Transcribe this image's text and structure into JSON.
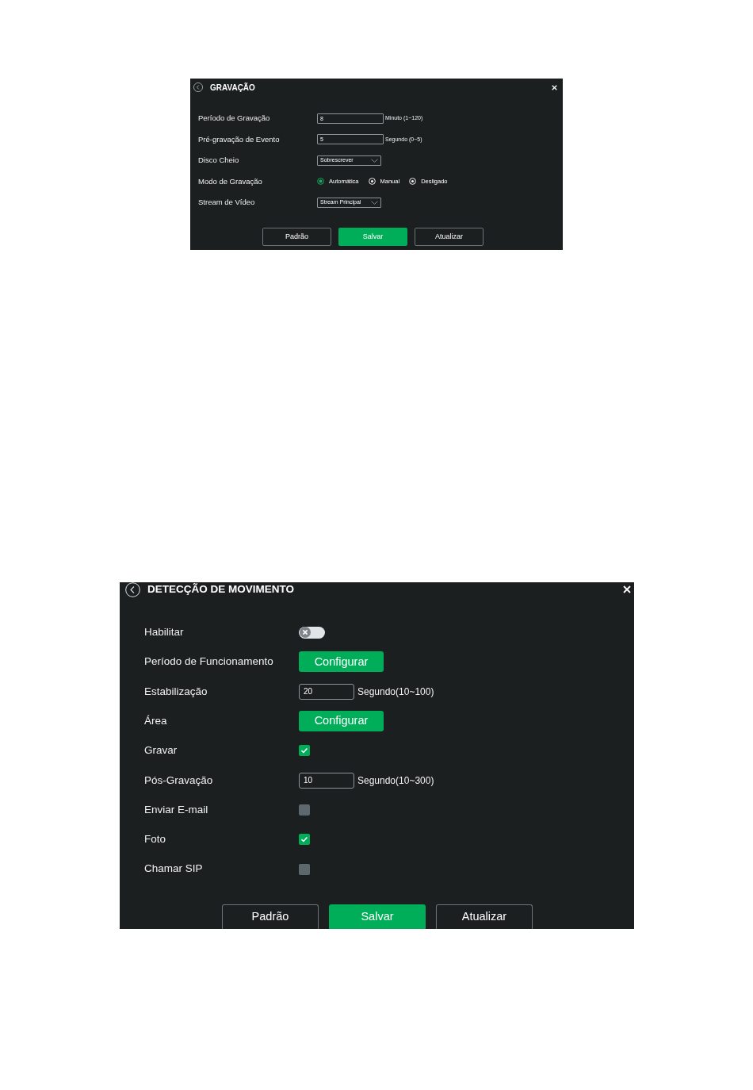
{
  "panels": [
    {
      "title": "GRAVAÇÃO",
      "rows": [
        {
          "kind": "input",
          "label": "Período de Gravação",
          "value": "8",
          "suffix": "Minuto (1~120)"
        },
        {
          "kind": "input",
          "label": "Pré-gravação de Evento",
          "value": "5",
          "suffix": "Segundo (0~5)"
        },
        {
          "kind": "select",
          "label": "Disco Cheio",
          "value": "Sobrescrever"
        },
        {
          "kind": "radio",
          "label": "Modo de Gravação",
          "options": [
            {
              "label": "Automática",
              "selected": true
            },
            {
              "label": "Manual",
              "selected": false
            },
            {
              "label": "Desligado",
              "selected": false
            }
          ]
        },
        {
          "kind": "select",
          "label": "Stream de Vídeo",
          "value": "Stream Principal"
        }
      ],
      "buttons": [
        {
          "label": "Padrão",
          "kind": "secondary"
        },
        {
          "label": "Salvar",
          "kind": "primary"
        },
        {
          "label": "Atualizar",
          "kind": "secondary"
        }
      ]
    },
    {
      "title": "DETECÇÃO DE MOVIMENTO",
      "rows": [
        {
          "kind": "toggle",
          "label": "Habilitar",
          "on": false
        },
        {
          "kind": "button",
          "label": "Período de Funcionamento",
          "button": "Configurar"
        },
        {
          "kind": "input",
          "label": "Estabilização",
          "value": "20",
          "suffix": "Segundo(10~100)"
        },
        {
          "kind": "button",
          "label": "Área",
          "button": "Configurar"
        },
        {
          "kind": "checkbox",
          "label": "Gravar",
          "checked": true
        },
        {
          "kind": "input",
          "label": "Pós-Gravação",
          "value": "10",
          "suffix": "Segundo(10~300)"
        },
        {
          "kind": "checkbox",
          "label": "Enviar E-mail",
          "checked": false
        },
        {
          "kind": "checkbox",
          "label": "Foto",
          "checked": true
        },
        {
          "kind": "checkbox",
          "label": "Chamar SIP",
          "checked": false
        }
      ],
      "buttons": [
        {
          "label": "Padrão",
          "kind": "secondary"
        },
        {
          "label": "Salvar",
          "kind": "primary"
        },
        {
          "label": "Atualizar",
          "kind": "secondary"
        }
      ]
    }
  ]
}
